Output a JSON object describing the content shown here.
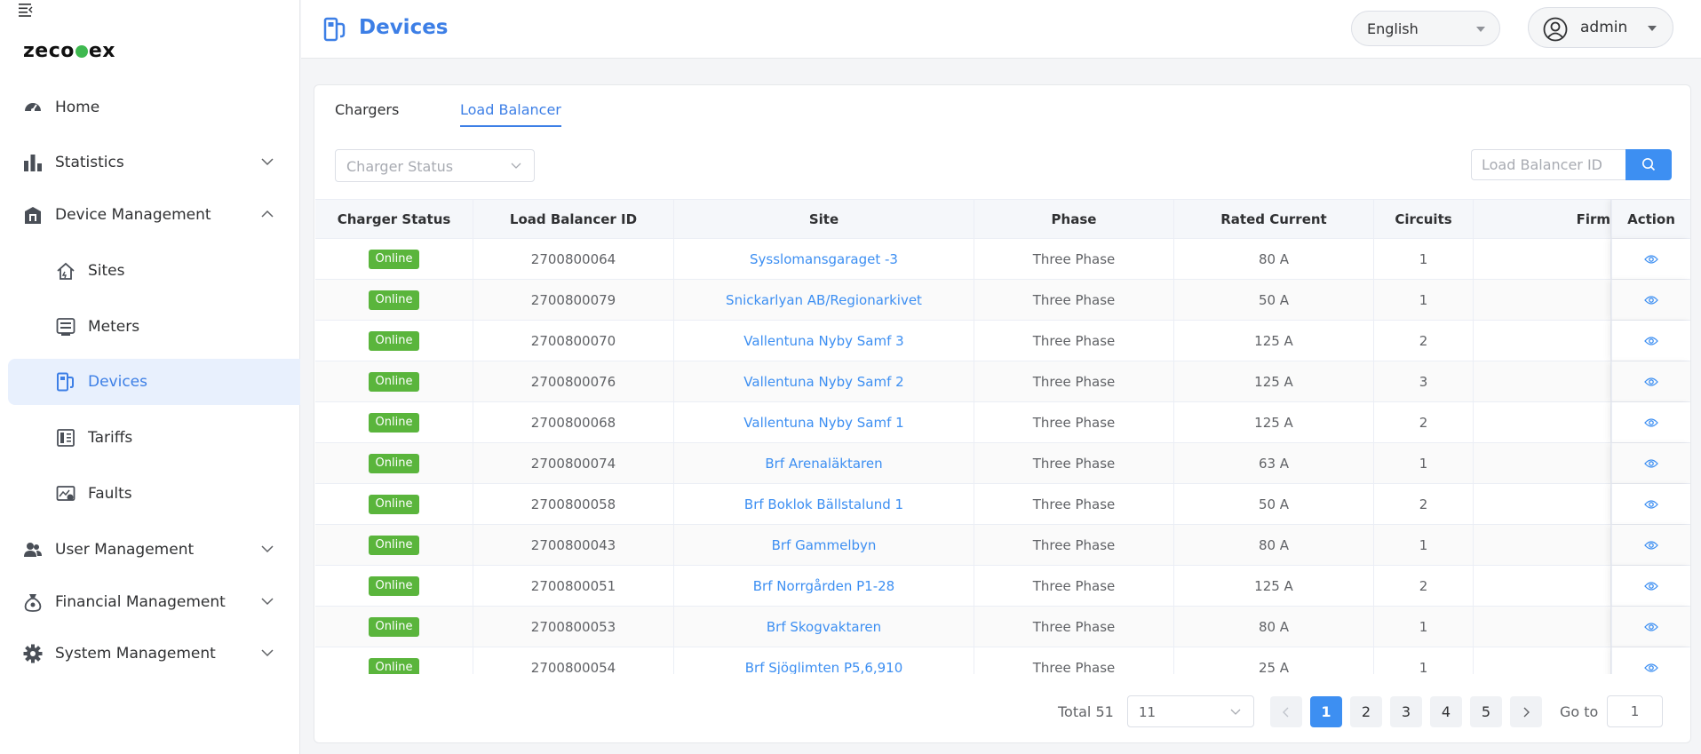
{
  "app": {
    "logo": "zeco",
    "logo_tail": "ex"
  },
  "sidebar": {
    "items": [
      {
        "label": "Home",
        "icon": "dashboard-icon"
      },
      {
        "label": "Statistics",
        "icon": "bar-chart-icon"
      },
      {
        "label": "Device Management",
        "icon": "building-icon"
      },
      {
        "label": "Sites",
        "icon": "house-icon"
      },
      {
        "label": "Meters",
        "icon": "meter-icon"
      },
      {
        "label": "Devices",
        "icon": "device-icon"
      },
      {
        "label": "Tariffs",
        "icon": "tariff-icon"
      },
      {
        "label": "Faults",
        "icon": "fault-icon"
      },
      {
        "label": "User Management",
        "icon": "users-icon"
      },
      {
        "label": "Financial Management",
        "icon": "money-bag-icon"
      },
      {
        "label": "System Management",
        "icon": "gear-icon"
      }
    ]
  },
  "header": {
    "title": "Devices",
    "language": "English",
    "user": "admin"
  },
  "tabs": [
    {
      "label": "Chargers"
    },
    {
      "label": "Load Balancer"
    }
  ],
  "filters": {
    "status_placeholder": "Charger Status",
    "search_placeholder": "Load Balancer ID"
  },
  "table": {
    "columns": [
      "Charger Status",
      "Load Balancer ID",
      "Site",
      "Phase",
      "Rated Current",
      "Circuits",
      "Firm",
      "Action"
    ],
    "rows": [
      {
        "status": "Online",
        "id": "2700800064",
        "site": "Sysslomansgaraget -3",
        "phase": "Three Phase",
        "current": "80 A",
        "circuits": "1"
      },
      {
        "status": "Online",
        "id": "2700800079",
        "site": "Snickarlyan AB/Regionarkivet",
        "phase": "Three Phase",
        "current": "50 A",
        "circuits": "1"
      },
      {
        "status": "Online",
        "id": "2700800070",
        "site": "Vallentuna Nyby Samf 3",
        "phase": "Three Phase",
        "current": "125 A",
        "circuits": "2"
      },
      {
        "status": "Online",
        "id": "2700800076",
        "site": "Vallentuna Nyby Samf 2",
        "phase": "Three Phase",
        "current": "125 A",
        "circuits": "3"
      },
      {
        "status": "Online",
        "id": "2700800068",
        "site": "Vallentuna Nyby Samf 1",
        "phase": "Three Phase",
        "current": "125 A",
        "circuits": "2"
      },
      {
        "status": "Online",
        "id": "2700800074",
        "site": "Brf Arenaläktaren",
        "phase": "Three Phase",
        "current": "63 A",
        "circuits": "1"
      },
      {
        "status": "Online",
        "id": "2700800058",
        "site": "Brf Boklok Bällstalund 1",
        "phase": "Three Phase",
        "current": "50 A",
        "circuits": "2"
      },
      {
        "status": "Online",
        "id": "2700800043",
        "site": "Brf Gammelbyn",
        "phase": "Three Phase",
        "current": "80 A",
        "circuits": "1"
      },
      {
        "status": "Online",
        "id": "2700800051",
        "site": "Brf Norrgården P1-28",
        "phase": "Three Phase",
        "current": "125 A",
        "circuits": "2"
      },
      {
        "status": "Online",
        "id": "2700800053",
        "site": "Brf Skogvaktaren",
        "phase": "Three Phase",
        "current": "80 A",
        "circuits": "1"
      },
      {
        "status": "Online",
        "id": "2700800054",
        "site": "Brf Sjöglimten P5,6,910",
        "phase": "Three Phase",
        "current": "25 A",
        "circuits": "1"
      }
    ]
  },
  "pagination": {
    "total_label": "Total 51",
    "page_size": "11",
    "pages": [
      "1",
      "2",
      "3",
      "4",
      "5"
    ],
    "current_page": "1",
    "goto_label": "Go to",
    "goto_value": "1"
  },
  "colors": {
    "accent": "#3d7fe6",
    "online": "#5ab53c",
    "link": "#3d8ff2"
  }
}
